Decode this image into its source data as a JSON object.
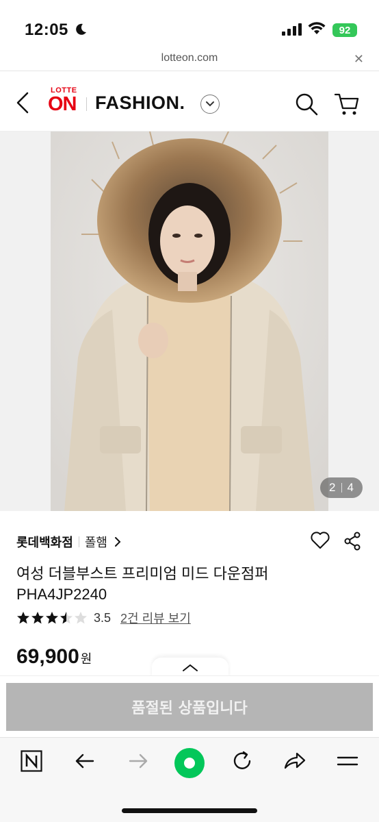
{
  "status_bar": {
    "time": "12:05",
    "battery": "92"
  },
  "browser": {
    "url": "lotteon.com"
  },
  "header": {
    "logo_top": "LOTTE",
    "logo_main": "ON",
    "section": "FASHION."
  },
  "gallery": {
    "current": "2",
    "total": "4"
  },
  "product": {
    "store": "롯데백화점",
    "brand": "폴햄",
    "title_line1": "여성 더블부스트 프리미엄 미드 다운점퍼",
    "title_line2": "PHA4JP2240",
    "rating": "3.5",
    "stars": 3.5,
    "review_link": "2건 리뷰 보기",
    "price": "69,900",
    "currency": "원"
  },
  "buy_bar": {
    "soldout_label": "품절된 상품입니다"
  },
  "colors": {
    "brand_red": "#e60012",
    "soldout_gray": "#b5b5b5",
    "naver_green": "#03c75a"
  }
}
